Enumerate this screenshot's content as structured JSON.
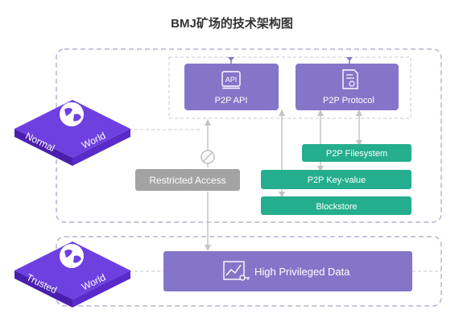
{
  "title": "BMJ矿场的技术架构图",
  "colors": {
    "purple": "#8575C8",
    "teal": "#25AE8D",
    "gray_box": "#A3A3A3",
    "dashed_border": "#B6B3D9",
    "inner_dashed": "#C8C8C8",
    "arrow": "#C4C4C4",
    "globe_top": "#6E40E0",
    "globe_side": "#4A1FAE"
  },
  "icons": {
    "api": "api-doc-icon",
    "protocol": "protocol-doc-icon",
    "data": "chart-key-icon",
    "globe": "globe-icon",
    "restricted": "blocked-circle-icon"
  },
  "normal_world": {
    "label_left": "Normal",
    "label_right": "World",
    "api_box": {
      "icon_text": "API",
      "label": "P2P API"
    },
    "protocol_box": {
      "label": "P2P Protocol"
    },
    "restricted": {
      "label": "Restricted Access"
    },
    "services": [
      {
        "label": "P2P Filesystem"
      },
      {
        "label": "P2P Key-value"
      },
      {
        "label": "Blockstore"
      }
    ]
  },
  "trusted_world": {
    "label_left": "Trusted",
    "label_right": "World",
    "data_box": {
      "label": "High Privileged Data"
    }
  }
}
